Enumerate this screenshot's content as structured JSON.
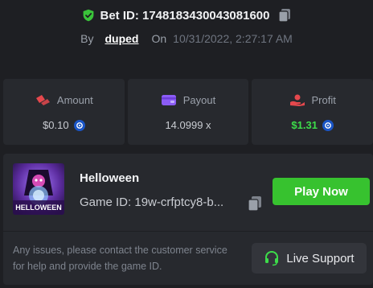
{
  "header": {
    "bet_id_label": "Bet ID: 1748183430043081600",
    "by_label": "By",
    "username": "duped",
    "on_label": "On",
    "date": "10/31/2022, 2:27:17 AM"
  },
  "stats": {
    "amount": {
      "label": "Amount",
      "value": "$0.10",
      "icon": "amount-icon"
    },
    "payout": {
      "label": "Payout",
      "value": "14.0999 x",
      "icon": "wallet-icon"
    },
    "profit": {
      "label": "Profit",
      "value": "$1.31",
      "icon": "profit-hand-icon"
    }
  },
  "game": {
    "name": "Helloween",
    "thumbnail_text": "HELLOWEEN",
    "game_id_label": "Game ID: 19w-crfptcy8-b...",
    "play_label": "Play Now"
  },
  "support": {
    "issues_text": "Any issues, please contact the customer service for help and provide the game ID.",
    "button_label": "Live Support"
  },
  "colors": {
    "background": "#1e1f23",
    "card": "#27292e",
    "accent_green": "#37c22f",
    "profit_green": "#3ddc4a",
    "shield_green": "#3ac43a",
    "icon_red": "#e5484d",
    "icon_purple": "#8b5cf6",
    "coin_blue": "#1a55c6"
  }
}
